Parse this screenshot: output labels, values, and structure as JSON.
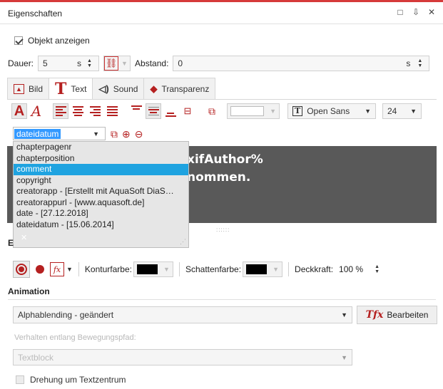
{
  "panel": {
    "title": "Eigenschaften"
  },
  "window_buttons": [
    "□",
    "⇩",
    "✕"
  ],
  "show_object": {
    "label": "Objekt anzeigen",
    "checked": true
  },
  "duration": {
    "label": "Dauer:",
    "value": "5",
    "unit": "s"
  },
  "spacing": {
    "label": "Abstand:",
    "value": "0",
    "unit": "s"
  },
  "tabs": [
    {
      "label": "Bild",
      "icon": "image-icon"
    },
    {
      "label": "Text",
      "icon": "text-T-icon",
      "active": true
    },
    {
      "label": "Sound",
      "icon": "speaker-icon"
    },
    {
      "label": "Transparenz",
      "icon": "transparency-icon"
    }
  ],
  "font": {
    "name": "Open Sans",
    "size": "24",
    "icon_letter": "T"
  },
  "text_color": "#ffffff",
  "placeholder_combo": {
    "selected": "dateidatum",
    "items": [
      "chapterpagenr",
      "chapterposition",
      "comment",
      "copyright",
      "creatorapp  - [Erstellt mit AquaSoft DiaS…",
      "creatorappurl  - [www.aquasoft.de]",
      "date  - [27.12.2018]",
      "dateidatum  - [15.06.2014]"
    ],
    "highlighted_index": 2
  },
  "preview": {
    "line1": "xifAuthor%",
    "line2": "nommen.",
    "resize_dots": "::::::",
    "close": "✕"
  },
  "effects": {
    "section_letter": "E",
    "contour_label": "Konturfarbe:",
    "contour_color": "#000000",
    "shadow_label": "Schattenfarbe:",
    "shadow_color": "#000000",
    "opacity_label": "Deckkraft:",
    "opacity_value": "100 %"
  },
  "animation": {
    "title": "Animation",
    "value": "Alphablending - geändert",
    "edit_label": "Bearbeiten",
    "path_label": "Verhalten entlang Bewegungspfad:",
    "path_value": "Textblock",
    "rotate_label": "Drehung um Textzentrum"
  },
  "colors": {
    "accent": "#b52020",
    "topbar": "#d63a3a",
    "highlight": "#1fa3e0",
    "preview_bg": "#595959"
  }
}
